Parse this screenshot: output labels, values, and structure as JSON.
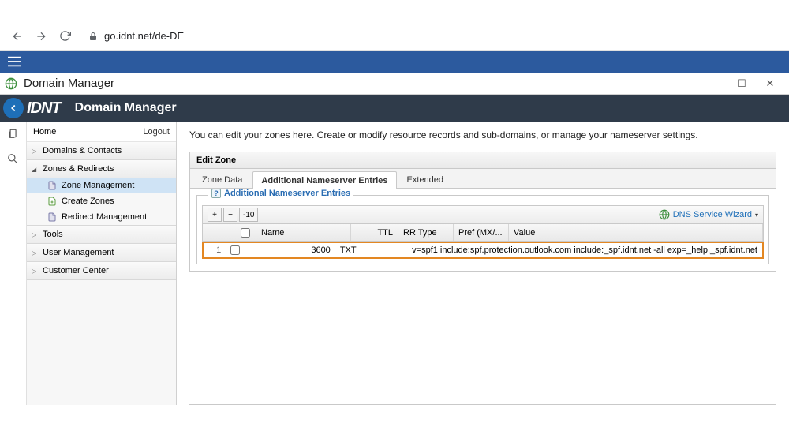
{
  "browser": {
    "url": "go.idnt.net/de-DE"
  },
  "appWindow": {
    "title": "Domain Manager"
  },
  "header": {
    "logo": "IDNT",
    "title": "Domain Manager"
  },
  "sidebar": {
    "home": "Home",
    "logout": "Logout",
    "groups": [
      {
        "label": "Domains & Contacts",
        "expanded": false,
        "items": []
      },
      {
        "label": "Zones & Redirects",
        "expanded": true,
        "items": [
          {
            "label": "Zone Management",
            "selected": true
          },
          {
            "label": "Create Zones",
            "selected": false
          },
          {
            "label": "Redirect Management",
            "selected": false
          }
        ]
      },
      {
        "label": "Tools",
        "expanded": false,
        "items": []
      },
      {
        "label": "User Management",
        "expanded": false,
        "items": []
      },
      {
        "label": "Customer Center",
        "expanded": false,
        "items": []
      }
    ]
  },
  "content": {
    "intro": "You can edit your zones here. Create or modify resource records and sub-domains, or manage your nameserver settings.",
    "panel_title": "Edit Zone",
    "tabs": [
      "Zone Data",
      "Additional Nameserver Entries",
      "Extended"
    ],
    "active_tab": 1,
    "fieldset_title": "Additional Nameserver Entries",
    "toolbar": {
      "add": "+",
      "remove": "−",
      "pager": "-10"
    },
    "dns_wizard": "DNS Service Wizard",
    "columns": {
      "idx": "",
      "cb": "",
      "name": "Name",
      "ttl": "TTL",
      "rr": "RR Type",
      "pref": "Pref (MX/...",
      "val": "Value"
    },
    "rows": [
      {
        "idx": "1",
        "name": "",
        "ttl": "3600",
        "rr": "TXT",
        "pref": "",
        "val": "v=spf1 include:spf.protection.outlook.com include:_spf.idnt.net -all exp=_help._spf.idnt.net"
      }
    ]
  }
}
